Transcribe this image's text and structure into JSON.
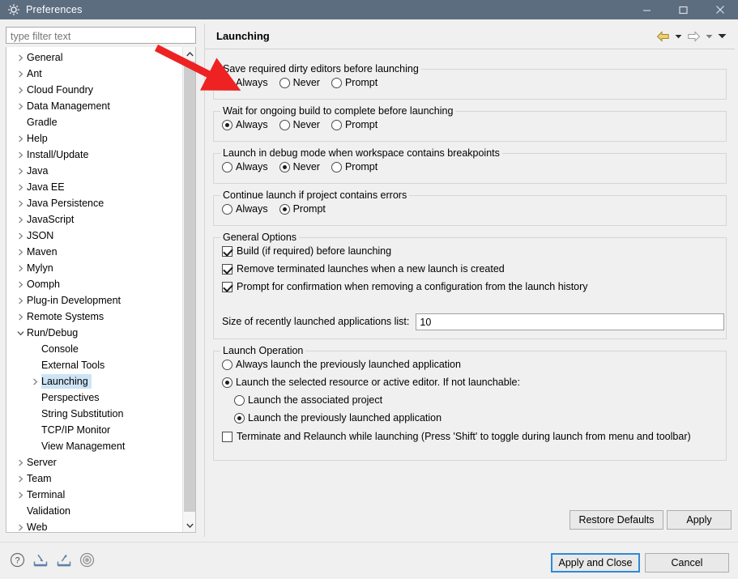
{
  "window": {
    "title": "Preferences",
    "icon": "preferences-gear-icon",
    "minimize_label": "–",
    "maximize_label": "□",
    "close_label": "✕",
    "titlebar_color": "#5d6d80"
  },
  "filter": {
    "placeholder": "type filter text",
    "value": ""
  },
  "tree": {
    "items": [
      {
        "label": "General",
        "level": 1,
        "expandable": true,
        "expanded": false,
        "selected": false
      },
      {
        "label": "Ant",
        "level": 1,
        "expandable": true,
        "expanded": false,
        "selected": false
      },
      {
        "label": "Cloud Foundry",
        "level": 1,
        "expandable": true,
        "expanded": false,
        "selected": false
      },
      {
        "label": "Data Management",
        "level": 1,
        "expandable": true,
        "expanded": false,
        "selected": false
      },
      {
        "label": "Gradle",
        "level": 1,
        "expandable": false,
        "expanded": false,
        "selected": false
      },
      {
        "label": "Help",
        "level": 1,
        "expandable": true,
        "expanded": false,
        "selected": false
      },
      {
        "label": "Install/Update",
        "level": 1,
        "expandable": true,
        "expanded": false,
        "selected": false
      },
      {
        "label": "Java",
        "level": 1,
        "expandable": true,
        "expanded": false,
        "selected": false
      },
      {
        "label": "Java EE",
        "level": 1,
        "expandable": true,
        "expanded": false,
        "selected": false
      },
      {
        "label": "Java Persistence",
        "level": 1,
        "expandable": true,
        "expanded": false,
        "selected": false
      },
      {
        "label": "JavaScript",
        "level": 1,
        "expandable": true,
        "expanded": false,
        "selected": false
      },
      {
        "label": "JSON",
        "level": 1,
        "expandable": true,
        "expanded": false,
        "selected": false
      },
      {
        "label": "Maven",
        "level": 1,
        "expandable": true,
        "expanded": false,
        "selected": false
      },
      {
        "label": "Mylyn",
        "level": 1,
        "expandable": true,
        "expanded": false,
        "selected": false
      },
      {
        "label": "Oomph",
        "level": 1,
        "expandable": true,
        "expanded": false,
        "selected": false
      },
      {
        "label": "Plug-in Development",
        "level": 1,
        "expandable": true,
        "expanded": false,
        "selected": false
      },
      {
        "label": "Remote Systems",
        "level": 1,
        "expandable": true,
        "expanded": false,
        "selected": false
      },
      {
        "label": "Run/Debug",
        "level": 1,
        "expandable": true,
        "expanded": true,
        "selected": false
      },
      {
        "label": "Console",
        "level": 2,
        "expandable": false,
        "expanded": false,
        "selected": false
      },
      {
        "label": "External Tools",
        "level": 2,
        "expandable": false,
        "expanded": false,
        "selected": false
      },
      {
        "label": "Launching",
        "level": 2,
        "expandable": true,
        "expanded": false,
        "selected": true
      },
      {
        "label": "Perspectives",
        "level": 2,
        "expandable": false,
        "expanded": false,
        "selected": false
      },
      {
        "label": "String Substitution",
        "level": 2,
        "expandable": false,
        "expanded": false,
        "selected": false
      },
      {
        "label": "TCP/IP Monitor",
        "level": 2,
        "expandable": false,
        "expanded": false,
        "selected": false
      },
      {
        "label": "View Management",
        "level": 2,
        "expandable": false,
        "expanded": false,
        "selected": false
      },
      {
        "label": "Server",
        "level": 1,
        "expandable": true,
        "expanded": false,
        "selected": false
      },
      {
        "label": "Team",
        "level": 1,
        "expandable": true,
        "expanded": false,
        "selected": false
      },
      {
        "label": "Terminal",
        "level": 1,
        "expandable": true,
        "expanded": false,
        "selected": false
      },
      {
        "label": "Validation",
        "level": 1,
        "expandable": false,
        "expanded": false,
        "selected": false
      },
      {
        "label": "Web",
        "level": 1,
        "expandable": true,
        "expanded": false,
        "selected": false
      }
    ],
    "selection_color": "#cde4f5"
  },
  "pane": {
    "title": "Launching",
    "nav": {
      "back_icon": "back-arrow-icon",
      "back_dropdown_icon": "chevron-down-icon",
      "forward_icon": "forward-arrow-icon",
      "forward_dropdown_icon": "chevron-down-icon",
      "menu_icon": "chevron-down-icon",
      "back_color": "#f0cf70",
      "forward_color": "#ffffff"
    }
  },
  "groups": {
    "save_dirty": {
      "legend": "Save required dirty editors before launching",
      "options": [
        {
          "label": "Always",
          "mnemonic": "A",
          "selected": true
        },
        {
          "label": "Never",
          "mnemonic": "e",
          "selected": false
        },
        {
          "label": "Prompt",
          "mnemonic": "m",
          "selected": false
        }
      ]
    },
    "wait_build": {
      "legend": "Wait for ongoing build to complete before launching",
      "options": [
        {
          "label": "Always",
          "mnemonic": "l",
          "selected": true
        },
        {
          "label": "Never",
          "mnemonic": "e",
          "selected": false
        },
        {
          "label": "Prompt",
          "mnemonic": "m",
          "selected": false
        }
      ]
    },
    "debug_breakpoints": {
      "legend": "Launch in debug mode when workspace contains breakpoints",
      "options": [
        {
          "label": "Always",
          "mnemonic": "s",
          "selected": false
        },
        {
          "label": "Never",
          "mnemonic": "r",
          "selected": true
        },
        {
          "label": "Prompt",
          "mnemonic": "t",
          "selected": false
        }
      ]
    },
    "continue_errors": {
      "legend": "Continue launch if project contains errors",
      "options": [
        {
          "label": "Always",
          "mnemonic": "w",
          "selected": false
        },
        {
          "label": "Prompt",
          "mnemonic": "o",
          "selected": true
        }
      ]
    },
    "general_options": {
      "legend": "General Options",
      "checkboxes": [
        {
          "label": "Build (if required) before launching",
          "checked": true
        },
        {
          "label": "Remove terminated launches when a new launch is created",
          "checked": true
        },
        {
          "label": "Prompt for confirmation when removing a configuration from the launch history",
          "checked": true
        }
      ],
      "size_label": "Size of recently launched applications list:",
      "size_value": "10"
    },
    "launch_operation": {
      "legend": "Launch Operation",
      "options": [
        {
          "label": "Always launch the previously launched application",
          "selected": false,
          "indent": 0
        },
        {
          "label": "Launch the selected resource or active editor. If not launchable:",
          "selected": true,
          "indent": 0
        },
        {
          "label": "Launch the associated project",
          "selected": false,
          "indent": 1
        },
        {
          "label": "Launch the previously launched application",
          "selected": true,
          "indent": 1
        }
      ],
      "terminate_checkbox": {
        "label": "Terminate and Relaunch while launching (Press 'Shift' to toggle during launch from menu and toolbar)",
        "checked": false
      }
    }
  },
  "buttons": {
    "restore_defaults": "Restore Defaults",
    "apply": "Apply",
    "apply_and_close": "Apply and Close",
    "cancel": "Cancel"
  },
  "footer": {
    "icons": [
      {
        "name": "help-icon",
        "title": "Help"
      },
      {
        "name": "import-icon",
        "title": "Import"
      },
      {
        "name": "export-icon",
        "title": "Export"
      },
      {
        "name": "target-icon",
        "title": "Link"
      }
    ]
  },
  "annotation": {
    "type": "red-arrow",
    "color": "#ee2222",
    "points_to": "save-dirty-always-radio"
  }
}
